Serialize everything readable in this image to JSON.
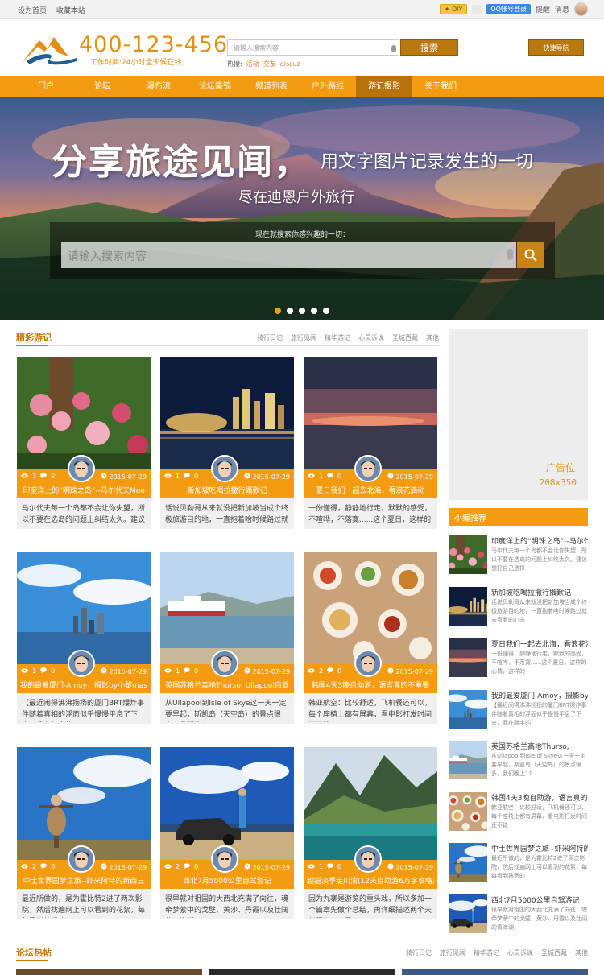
{
  "topbar": {
    "left": [
      "设为首页",
      "收藏本站"
    ],
    "diy": "DIY",
    "qq": "QQ帐号登录",
    "remind": "提醒",
    "msg": "消息"
  },
  "header": {
    "phone": "400-123-456",
    "slogan": "工作时间:24小时全天候在线",
    "search_placeholder": "请输入搜索内容",
    "search_btn": "搜索",
    "hot_label": "热搜:",
    "hot": [
      "活动",
      "交友",
      "discuz"
    ],
    "quick": "快捷导航"
  },
  "nav": [
    {
      "label": "门户"
    },
    {
      "label": "论坛"
    },
    {
      "label": "瀑布流"
    },
    {
      "label": "论坛集锦"
    },
    {
      "label": "频道列表"
    },
    {
      "label": "户外路线"
    },
    {
      "label": "游记摄影",
      "active": true
    },
    {
      "label": "关于我们"
    }
  ],
  "banner": {
    "title": "分享旅途见闻",
    "comma": "，",
    "subtitle": "用文字图片记录发生的一切",
    "subtitle2": "尽在迪恩户外旅行",
    "hint": "现在就搜索你感兴趣的一切：",
    "placeholder": "请输入搜索内容"
  },
  "section1": {
    "title": "精彩游记",
    "tabs": [
      "骑行日记",
      "旅行见闻",
      "精华游记",
      "心灵诉说",
      "圣城西藏",
      "其他"
    ]
  },
  "cards": [
    {
      "views": "1",
      "comments": "0",
      "date": "2015-07-29",
      "title": "印度洋上的“明珠之岛”--马尔代夫Moo",
      "desc": "马尔代夫每一个岛都不会让你失望，所以不要在选岛的问题上纠结太久。建议想好自己选择",
      "img": "flowers"
    },
    {
      "views": "1",
      "comments": "0",
      "date": "2015-07-29",
      "title": "新加坡吃喝拉撒行攝歎记",
      "desc": "话说贝勒哥从来就没把新加坡当成个终极旅游目的地，一直抱着啥时候路过就去看看的心态",
      "img": "night"
    },
    {
      "views": "1",
      "comments": "0",
      "date": "2015-07-29",
      "title": "夏日我们一起去北海，看浪花滴动",
      "desc": "一份懂得，静静地行走，默默的感受，不喧哗，不落寞......这个夏日，这样的心情，这样的",
      "img": "sunset"
    },
    {
      "views": "1",
      "comments": "0",
      "date": "2015-07-29",
      "title": "我的最爱厦门-Amoy，摄影by小黎maste",
      "desc": "【最近闹得沸沸扬扬的厦门BRT爆炸事件随着真相的浮面似乎慢慢平息了下来，我在敲字的",
      "img": "city"
    },
    {
      "views": "1",
      "comments": "0",
      "date": "2015-07-29",
      "title": "英国苏格兰高地Thurso, Ullapool自驾",
      "desc": "从Ullapool到Isle of Skye这一天一定要早起，斯凯岛（天空岛）的景点很多，我们晚上11",
      "img": "ship"
    },
    {
      "views": "2",
      "comments": "0",
      "date": "2015-07-29",
      "title": "韩国4天3晚自助游，语言真的不重要",
      "desc": "韩亚航空：比较舒适，飞机餐还可以，每个座椅上都有屏幕，看电影打发时间还不错",
      "img": "food"
    },
    {
      "views": "2",
      "comments": "0",
      "date": "2015-07-29",
      "title": "中土世界园梦之旅--虾米阿特的新西三",
      "desc": "最近所做的，是为霍比特2进了两次影院，然后找遍网上可以看到的花絮，每每看到熟悉的",
      "img": "scarecrow"
    },
    {
      "views": "2",
      "comments": "0",
      "date": "2015-07-29",
      "title": "西北7月5000公里自驾游记",
      "desc": "很早就对祖国的大西北充满了向往，魂牵梦萦中的戈壁、黄沙、丹霞以及壮阔的青海湖，一",
      "img": "car"
    },
    {
      "views": "1",
      "comments": "0",
      "date": "2015-07-29",
      "title": "越描淡季走川渝(12天自助游6万字攻略)",
      "desc": "因为九寨是游览的重头戏，所以多加一个篇章先做个总结，再详细描述两个天行程及各个景",
      "img": "lake"
    }
  ],
  "ad": {
    "label": "广告位",
    "size": "208x350"
  },
  "sidebar": {
    "title": "小编推荐",
    "items": [
      {
        "title": "印度洋上的“明珠之岛”--马尔代",
        "desc": "马尔代夫每一个岛都不会让你失望，所以不要在选岛的问题上纠结太久。建议想好自己选择",
        "img": "flowers"
      },
      {
        "title": "新加坡吃喝拉撒行攝歎记",
        "desc": "话说贝勒哥从来就没把新加坡当成个终极旅游目的地，一直抱着啥时候路过就去看看的心态",
        "img": "night"
      },
      {
        "title": "夏日我们一起去北海，看浪花滴",
        "desc": "一份懂得，静静地行走，默默的感受，不喧哗，不落寞......这个夏日，这样的心情，这样的",
        "img": "sunset"
      },
      {
        "title": "我的最爱厦门-Amoy，摄影by小",
        "desc": "【最近闹得沸沸扬扬的厦门BRT爆炸事件随着真相的浮面似乎慢慢平息了下来，我在敲字的",
        "img": "city"
      },
      {
        "title": "英国苏格兰高地Thurso,",
        "desc": "从Ullapool到Isle of Skye这一天一定要早起，斯凯岛（天空岛）的景点很多，我们晚上11",
        "img": "ship"
      },
      {
        "title": "韩国4天3晚自助游，语言真的",
        "desc": "韩亚航空：比较舒适，飞机餐还可以，每个座椅上都有屏幕，看电影打发时间还不错",
        "img": "food"
      },
      {
        "title": "中土世界园梦之旅--虾米阿特的",
        "desc": "最近所做的，是为霍比特2进了两次影院，然后找遍网上可以看到的花絮，每每看到熟悉的",
        "img": "scarecrow"
      },
      {
        "title": "西北7月5000公里自驾游记",
        "desc": "很早就对祖国的大西北充满了向往，魂牵梦萦中的戈壁、黄沙、丹霞以及壮阔的青海湖，一",
        "img": "car"
      }
    ]
  },
  "section2": {
    "title": "论坛热帖",
    "tabs": [
      "骑行日记",
      "旅行见闻",
      "精华游记",
      "心灵诉说",
      "圣城西藏",
      "其他"
    ]
  },
  "colors": {
    "accent": "#f39c12",
    "dark_accent": "#b8720b",
    "title_brown": "#c77900"
  }
}
